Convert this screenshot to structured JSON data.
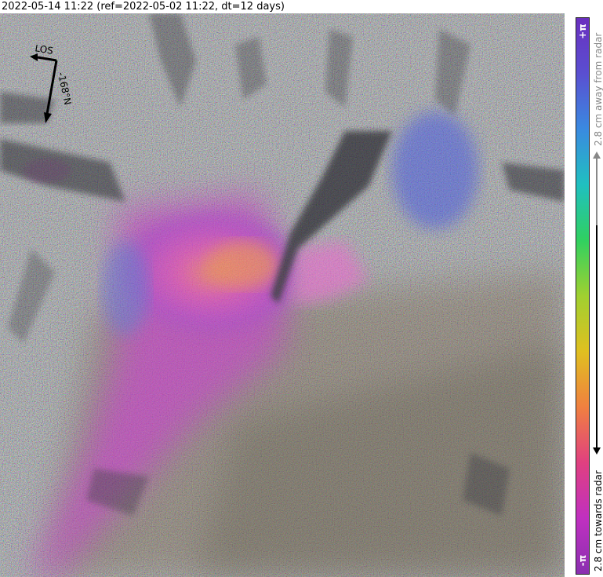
{
  "title": "2022-05-14 11:22 (ref=2022-05-02 11:22, dt=12 days)",
  "compass": {
    "los_label": "LOS",
    "heading_label": "-168°N"
  },
  "colorbar": {
    "top_label": "+π",
    "bottom_label": "-π",
    "away_label": "2.8 cm away from radar",
    "towards_label": "2.8 cm towards radar",
    "colors": [
      "#6a2fbf",
      "#5a4fd1",
      "#3a8ae0",
      "#20c0c0",
      "#30d060",
      "#a0d030",
      "#e0c020",
      "#f08040",
      "#e04080",
      "#c030c0",
      "#8a2fb0"
    ]
  },
  "map": {
    "description_colors": {
      "noise_gray": "#8a8f96",
      "deformation_magenta": "#d040c0",
      "deformation_orange": "#f08a50",
      "deformation_blue": "#4a70d8",
      "shadow": "#2a2a30"
    }
  }
}
